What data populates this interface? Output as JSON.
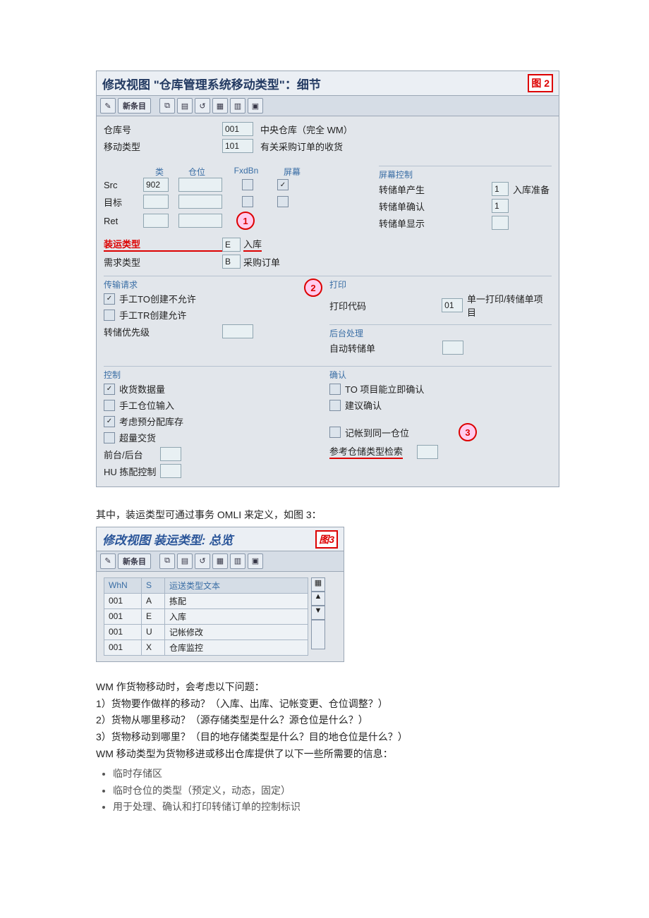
{
  "fig2": {
    "title": "修改视图 \"仓库管理系统移动类型\"：细节",
    "badge": "图 2",
    "toolbar": {
      "new": "新条目"
    },
    "fields": {
      "warehouse_label": "仓库号",
      "warehouse_val": "001",
      "warehouse_desc": "中央仓库（完全 WM）",
      "movetype_label": "移动类型",
      "movetype_val": "101",
      "movetype_desc": "有关采购订单的收货"
    },
    "grid": {
      "col_type": "类",
      "col_bin": "仓位",
      "col_fxdbn": "FxdBn",
      "col_scr": "屏幕",
      "row_src": "Src",
      "src_type": "902",
      "row_dst": "目标",
      "row_ret": "Ret"
    },
    "screenctl": {
      "title": "屏幕控制",
      "gen_label": "转储单产生",
      "gen_val": "1",
      "gen_desc": "入库准备",
      "conf_label": "转储单确认",
      "conf_val": "1",
      "disp_label": "转储单显示"
    },
    "ship_label": "装运类型",
    "ship_val": "E",
    "ship_desc": "入库",
    "req_label": "需求类型",
    "req_val": "B",
    "req_desc": "采购订单",
    "tr": {
      "title": "传输请求",
      "manual_to": "手工TO创建不允许",
      "manual_tr": "手工TR创建允许",
      "priority": "转储优先级"
    },
    "print": {
      "title": "打印",
      "code_label": "打印代码",
      "code_val": "01",
      "code_desc": "单一打印/转储单项目"
    },
    "bg": {
      "title": "后台处理",
      "auto": "自动转储单"
    },
    "ctrl": {
      "title": "控制",
      "gr": "收货数据量",
      "man_bin": "手工仓位输入",
      "prealloc": "考虑预分配库存",
      "over": "超量交货",
      "fgbg": "前台/后台",
      "hu": "HU 拣配控制"
    },
    "confirm": {
      "title": "确认",
      "imm": "TO 项目能立即确认",
      "sug": "建议确认",
      "same": "记帐到同一仓位",
      "ref": "参考仓储类型检索"
    },
    "callouts": {
      "c1": "1",
      "c2": "2",
      "c3": "3"
    }
  },
  "midtext": "其中，装运类型可通过事务 OMLI 来定义，如图 3：",
  "fig3": {
    "title": "修改视图 装运类型: 总览",
    "badge": "图3",
    "toolbar": {
      "new": "新条目"
    },
    "headers": {
      "whn": "WhN",
      "s": "S",
      "text": "运送类型文本"
    },
    "rows": [
      {
        "whn": "001",
        "s": "A",
        "text": "拣配"
      },
      {
        "whn": "001",
        "s": "E",
        "text": "入库"
      },
      {
        "whn": "001",
        "s": "U",
        "text": "记帐修改"
      },
      {
        "whn": "001",
        "s": "X",
        "text": "仓库监控"
      }
    ]
  },
  "prose": {
    "p1": "WM 作货物移动时，会考虑以下问题：",
    "p2": "1）货物要作做样的移动？（入库、出库、记帐变更、仓位调整？）",
    "p3": "2）货物从哪里移动？（源存储类型是什么？源仓位是什么？）",
    "p4": "3）货物移动到哪里？（目的地存储类型是什么？目的地仓位是什么？）",
    "p5": "WM 移动类型为货物移进或移出仓库提供了以下一些所需要的信息：",
    "li1": "临时存储区",
    "li2": "临时仓位的类型（预定义，动态，固定）",
    "li3": "用于处理、确认和打印转储订单的控制标识"
  }
}
